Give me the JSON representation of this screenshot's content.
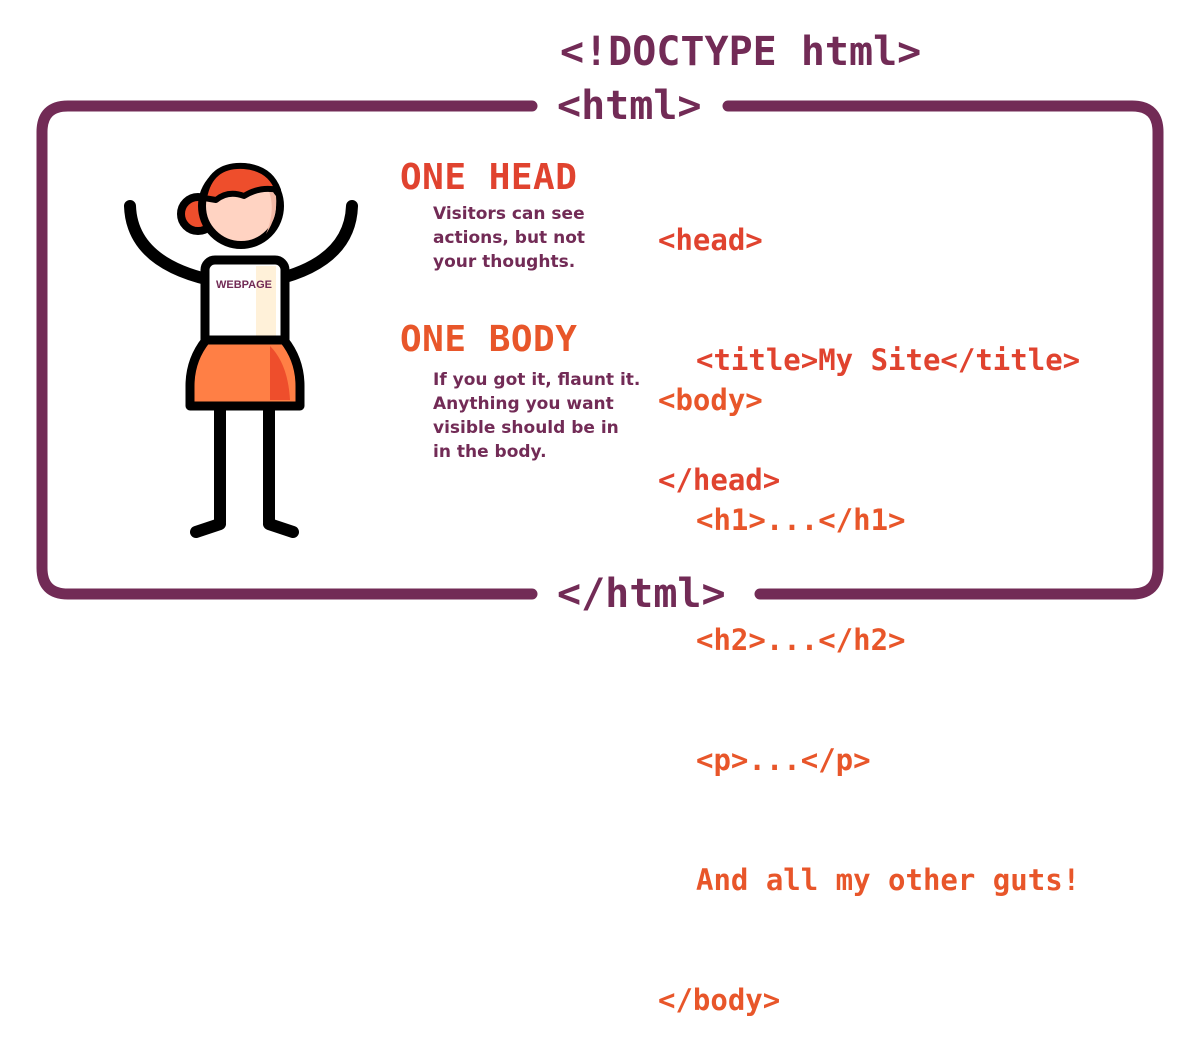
{
  "doctype_tag": "<!DOCTYPE html>",
  "html_open_tag": "<html>",
  "html_close_tag": "</html>",
  "figure": {
    "shirt_label": "WEBPAGE"
  },
  "head_section": {
    "title": "ONE HEAD",
    "note_lines": [
      "Visitors can see",
      "actions, but not",
      "your thoughts."
    ],
    "code_lines": [
      "<head>",
      "<title>My Site</title>",
      "</head>"
    ]
  },
  "body_section": {
    "title": "ONE BODY",
    "note_lines": [
      "If you got it, flaunt it.",
      "Anything you want",
      "visible should be in",
      "in the body."
    ],
    "code_lines": [
      "<body>",
      "<h1>...</h1>",
      "<h2>...</h2>",
      "<p>...</p>",
      "And all my other guts!",
      "</body>"
    ]
  },
  "colors": {
    "frame": "#722b56",
    "head_accent": "#e0432f",
    "body_accent": "#e8562a",
    "skirt": "#ff7f45",
    "hair": "#ee4e2c",
    "skin": "#ffd3c2",
    "outline": "#000000"
  }
}
